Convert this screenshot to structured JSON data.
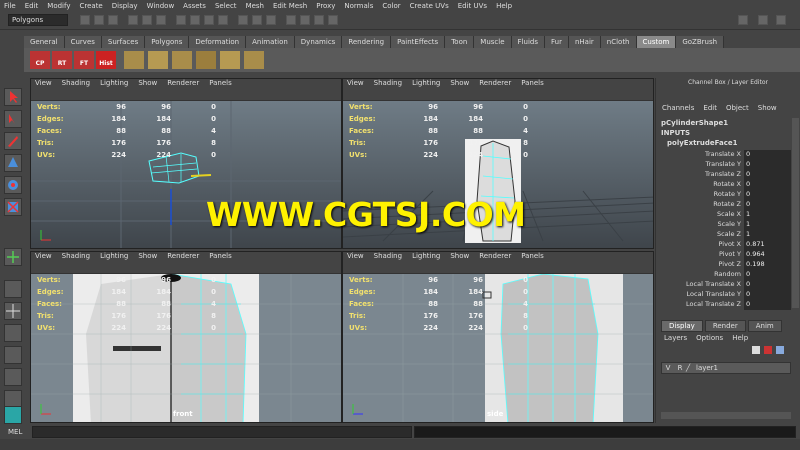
{
  "menus": [
    "File",
    "Edit",
    "Modify",
    "Create",
    "Display",
    "Window",
    "Assets",
    "Select",
    "Mesh",
    "Edit Mesh",
    "Proxy",
    "Normals",
    "Color",
    "Create UVs",
    "Edit UVs",
    "Help"
  ],
  "mode_selector": "Polygons",
  "shelf_tabs": [
    "General",
    "Curves",
    "Surfaces",
    "Polygons",
    "Deformation",
    "Animation",
    "Dynamics",
    "Rendering",
    "PaintEffects",
    "Toon",
    "Muscle",
    "Fluids",
    "Fur",
    "nHair",
    "nCloth",
    "Custom",
    "GoZBrush"
  ],
  "active_shelf_tab": "Custom",
  "shelf_buttons": [
    "CP",
    "RT",
    "FT",
    "Hist"
  ],
  "viewport_menu": [
    "View",
    "Shading",
    "Lighting",
    "Show",
    "Renderer",
    "Panels"
  ],
  "hud": {
    "labels": [
      "Verts:",
      "Edges:",
      "Faces:",
      "Tris:",
      "UVs:"
    ],
    "col1": [
      "96",
      "184",
      "88",
      "176",
      "224"
    ],
    "col2": [
      "96",
      "184",
      "88",
      "176",
      "224"
    ],
    "col3": [
      "0",
      "0",
      "4",
      "8",
      "0"
    ]
  },
  "viewport_labels": {
    "front": "front",
    "side": "side"
  },
  "channel_box": {
    "title": "Channel Box / Layer Editor",
    "menu": [
      "Channels",
      "Edit",
      "Object",
      "Show"
    ],
    "node": "pCylinderShape1",
    "inputs_label": "INPUTS",
    "input_node": "polyExtrudeFace1",
    "attributes": [
      {
        "name": "Translate X",
        "value": "0"
      },
      {
        "name": "Translate Y",
        "value": "0"
      },
      {
        "name": "Translate Z",
        "value": "0"
      },
      {
        "name": "Rotate X",
        "value": "0"
      },
      {
        "name": "Rotate Y",
        "value": "0"
      },
      {
        "name": "Rotate Z",
        "value": "0"
      },
      {
        "name": "Scale X",
        "value": "1"
      },
      {
        "name": "Scale Y",
        "value": "1"
      },
      {
        "name": "Scale Z",
        "value": "1"
      },
      {
        "name": "Pivot X",
        "value": "0.871"
      },
      {
        "name": "Pivot Y",
        "value": "0.964"
      },
      {
        "name": "Pivot Z",
        "value": "0.198"
      },
      {
        "name": "Random",
        "value": "0"
      },
      {
        "name": "Local Translate X",
        "value": "0"
      },
      {
        "name": "Local Translate Y",
        "value": "0"
      },
      {
        "name": "Local Translate Z",
        "value": "0"
      }
    ]
  },
  "layer_editor": {
    "tabs": [
      "Display",
      "Render",
      "Anim"
    ],
    "active_tab": "Display",
    "menu": [
      "Layers",
      "Options",
      "Help"
    ],
    "layer": {
      "v": "V",
      "r": "R",
      "name": "layer1"
    }
  },
  "command_line": {
    "label": "MEL"
  },
  "watermark": "WWW.CGTSJ.COM"
}
